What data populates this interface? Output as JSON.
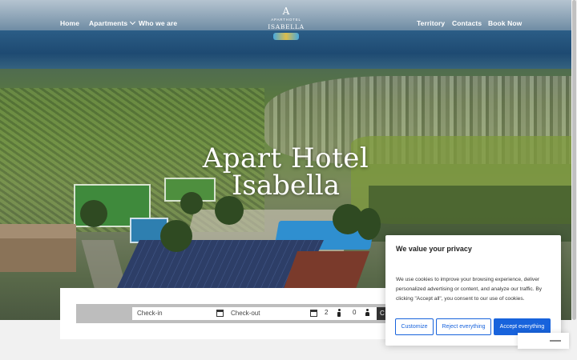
{
  "nav": {
    "home": "Home",
    "apartments": "Apartments",
    "who_we_are": "Who we are",
    "territory": "Territory",
    "contacts": "Contacts",
    "book_now": "Book Now"
  },
  "logo": {
    "mark": "A",
    "small": "APARTHOTEL",
    "name": "ISABELLA"
  },
  "hero": {
    "title_line1": "Apart Hotel",
    "title_line2": "Isabella"
  },
  "booking": {
    "checkin_placeholder": "Check-in",
    "checkout_placeholder": "Check-out",
    "adults": "2",
    "children": "0",
    "submit_label": "C"
  },
  "cookie": {
    "title": "We value your privacy",
    "text": "We use cookies to improve your browsing experience, deliver personalized advertising or content, and analyze our traffic. By clicking \"Accept all\", you consent to our use of cookies.",
    "customize": "Customize",
    "reject": "Reject everything",
    "accept": "Accept everything",
    "brand_color": "#1863dc"
  },
  "icons": {
    "calendar": "calendar-icon",
    "adult": "adult-icon",
    "child": "child-icon",
    "dropdown": "chevron-down-icon"
  }
}
